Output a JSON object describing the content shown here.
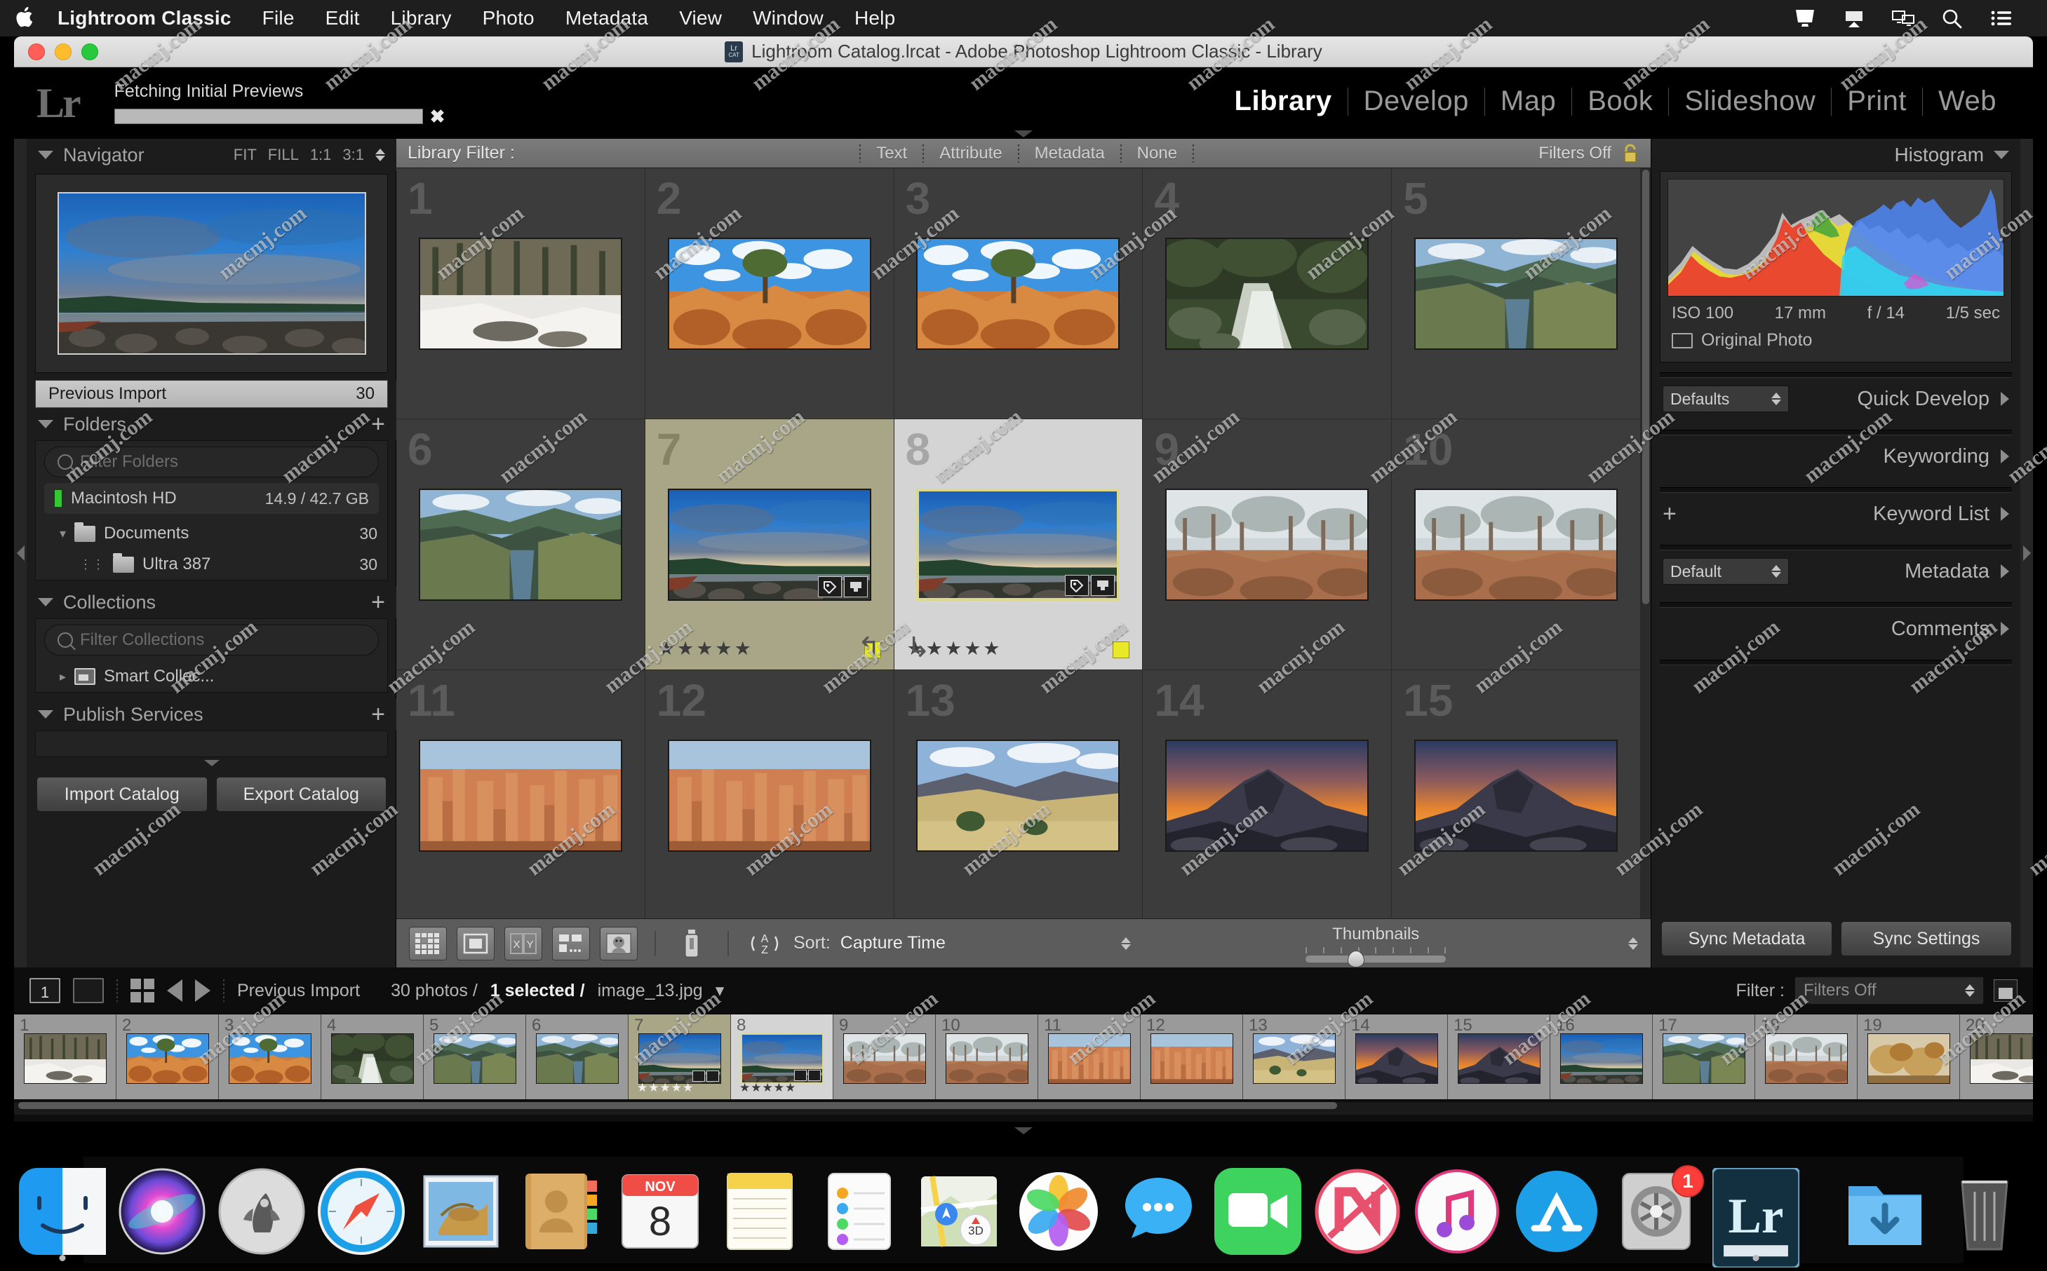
{
  "menubar": {
    "apple_icon": "apple-logo",
    "items": [
      {
        "label": "Lightroom Classic",
        "bold": true
      },
      {
        "label": "File"
      },
      {
        "label": "Edit"
      },
      {
        "label": "Library"
      },
      {
        "label": "Photo"
      },
      {
        "label": "Metadata"
      },
      {
        "label": "View"
      },
      {
        "label": "Window"
      },
      {
        "label": "Help"
      }
    ],
    "status_icons": [
      "display-icon",
      "airplay-icon",
      "screen-mirroring-icon",
      "search-icon",
      "control-center-icon"
    ]
  },
  "window": {
    "title": "Lightroom Catalog.lrcat - Adobe Photoshop Lightroom Classic - Library",
    "traffic_lights": [
      "close",
      "minimize",
      "zoom"
    ]
  },
  "identity": {
    "logo": "Lr",
    "progress_label": "Fetching Initial Previews",
    "progress_percent": 0,
    "close_label": "✖"
  },
  "modules": [
    {
      "label": "Library",
      "active": true
    },
    {
      "label": "Develop",
      "active": false
    },
    {
      "label": "Map",
      "active": false
    },
    {
      "label": "Book",
      "active": false
    },
    {
      "label": "Slideshow",
      "active": false
    },
    {
      "label": "Print",
      "active": false
    },
    {
      "label": "Web",
      "active": false
    }
  ],
  "left_panel": {
    "navigator": {
      "title": "Navigator",
      "zoom_levels": [
        "FIT",
        "FILL",
        "1:1",
        "3:1"
      ]
    },
    "catalog": {
      "previous_import_label": "Previous Import",
      "previous_import_count": "30"
    },
    "folders": {
      "title": "Folders",
      "filter_placeholder": "Filter Folders",
      "volume": {
        "name": "Macintosh HD",
        "space": "14.9 / 42.7 GB"
      },
      "items": [
        {
          "name": "Documents",
          "count": "30",
          "depth": 1
        },
        {
          "name": "Ultra 387",
          "count": "30",
          "depth": 2
        }
      ]
    },
    "collections": {
      "title": "Collections",
      "filter_placeholder": "Filter Collections",
      "items": [
        {
          "name": "Smart Collec..."
        }
      ]
    },
    "publish_services": {
      "title": "Publish Services"
    },
    "buttons": {
      "import": "Import Catalog",
      "export": "Export Catalog"
    }
  },
  "library_filter": {
    "label": "Library Filter :",
    "tabs": [
      "Text",
      "Attribute",
      "Metadata",
      "None"
    ],
    "status": "Filters Off",
    "lock_icon": "lock-icon"
  },
  "grid": {
    "cells": [
      {
        "num": "1",
        "state": "normal",
        "img": "snow-forest",
        "stars": 0,
        "badges": false,
        "label": false
      },
      {
        "num": "2",
        "state": "normal",
        "img": "arches-tree",
        "stars": 0,
        "badges": false,
        "label": false
      },
      {
        "num": "3",
        "state": "normal",
        "img": "arches-tree2",
        "stars": 0,
        "badges": false,
        "label": false
      },
      {
        "num": "4",
        "state": "normal",
        "img": "mossy-creek",
        "stars": 0,
        "badges": false,
        "label": false
      },
      {
        "num": "5",
        "state": "normal",
        "img": "canyon-river",
        "stars": 0,
        "badges": false,
        "label": false
      },
      {
        "num": "6",
        "state": "normal",
        "img": "canyon-river2",
        "stars": 0,
        "badges": false,
        "label": false
      },
      {
        "num": "7",
        "state": "selected",
        "img": "maui-storm",
        "stars": 5,
        "badges": true,
        "label": true
      },
      {
        "num": "8",
        "state": "active",
        "img": "maui-storm",
        "stars": 5,
        "badges": true,
        "label": true
      },
      {
        "num": "9",
        "state": "normal",
        "img": "misty-lake",
        "stars": 0,
        "badges": false,
        "label": false
      },
      {
        "num": "10",
        "state": "normal",
        "img": "misty-lake2",
        "stars": 0,
        "badges": false,
        "label": false
      },
      {
        "num": "11",
        "state": "normal",
        "img": "bryce-hoodoos",
        "stars": 0,
        "badges": false,
        "label": false
      },
      {
        "num": "12",
        "state": "normal",
        "img": "bryce-hoodoos2",
        "stars": 0,
        "badges": false,
        "label": false
      },
      {
        "num": "13",
        "state": "normal",
        "img": "prairie-hills",
        "stars": 0,
        "badges": false,
        "label": false
      },
      {
        "num": "14",
        "state": "normal",
        "img": "halfdome-sunset",
        "stars": 0,
        "badges": false,
        "label": false
      },
      {
        "num": "15",
        "state": "normal",
        "img": "halfdome-sunset2",
        "stars": 0,
        "badges": false,
        "label": false
      }
    ],
    "star_glyph": "★★★★★",
    "color_label": "#e9e92a"
  },
  "toolbar": {
    "view_icons": [
      "grid-view-icon",
      "loupe-view-icon",
      "compare-view-icon",
      "survey-view-icon",
      "people-view-icon"
    ],
    "paint_icon": "spray-can-icon",
    "sort_direction_icon": "sort-az-icon",
    "sort_label": "Sort:",
    "sort_value": "Capture Time",
    "thumbnails_label": "Thumbnails",
    "thumbnail_slider_value": 30
  },
  "right_panel": {
    "histogram": {
      "title": "Histogram",
      "iso": "ISO 100",
      "focal": "17 mm",
      "aperture": "f / 14",
      "shutter": "1/5 sec",
      "original_photo": "Original Photo"
    },
    "sections": [
      {
        "title": "Quick Develop",
        "dropdown": "Defaults",
        "plus": false
      },
      {
        "title": "Keywording",
        "dropdown": null,
        "plus": false
      },
      {
        "title": "Keyword List",
        "dropdown": null,
        "plus": true
      },
      {
        "title": "Metadata",
        "dropdown": "Default",
        "plus": false
      },
      {
        "title": "Comments",
        "dropdown": null,
        "plus": false
      }
    ],
    "buttons": {
      "sync_metadata": "Sync Metadata",
      "sync_settings": "Sync Settings"
    }
  },
  "filmstrip": {
    "window_num": "1",
    "source": "Previous Import",
    "count_text": "30 photos /",
    "selected_text": "1 selected /",
    "filename": "image_13.jpg",
    "filter_label": "Filter :",
    "filter_value": "Filters Off",
    "cells": [
      {
        "num": "1",
        "img": "snow-forest",
        "state": "normal",
        "stars": 0
      },
      {
        "num": "2",
        "img": "arches-tree",
        "state": "normal",
        "stars": 0
      },
      {
        "num": "3",
        "img": "arches-tree2",
        "state": "normal",
        "stars": 0
      },
      {
        "num": "4",
        "img": "mossy-creek",
        "state": "normal",
        "stars": 0
      },
      {
        "num": "5",
        "img": "canyon-river",
        "state": "normal",
        "stars": 0
      },
      {
        "num": "6",
        "img": "canyon-river2",
        "state": "normal",
        "stars": 0
      },
      {
        "num": "7",
        "img": "maui-storm",
        "state": "selected",
        "stars": 5
      },
      {
        "num": "8",
        "img": "maui-storm",
        "state": "active",
        "stars": 5
      },
      {
        "num": "9",
        "img": "misty-lake",
        "state": "normal",
        "stars": 0
      },
      {
        "num": "10",
        "img": "misty-lake2",
        "state": "normal",
        "stars": 0
      },
      {
        "num": "11",
        "img": "bryce-hoodoos",
        "state": "normal",
        "stars": 0
      },
      {
        "num": "12",
        "img": "bryce-hoodoos2",
        "state": "normal",
        "stars": 0
      },
      {
        "num": "13",
        "img": "prairie-hills",
        "state": "normal",
        "stars": 0
      },
      {
        "num": "14",
        "img": "halfdome-sunset",
        "state": "normal",
        "stars": 0
      },
      {
        "num": "15",
        "img": "halfdome-sunset2",
        "state": "normal",
        "stars": 0
      },
      {
        "num": "16",
        "img": "maui-storm",
        "state": "normal",
        "stars": 0
      },
      {
        "num": "17",
        "img": "canyon-river",
        "state": "normal",
        "stars": 0
      },
      {
        "num": "18",
        "img": "misty-lake",
        "state": "normal",
        "stars": 0
      },
      {
        "num": "19",
        "img": "autumn-leaf",
        "state": "normal",
        "stars": 0
      },
      {
        "num": "20",
        "img": "snow-forest",
        "state": "normal",
        "stars": 0
      }
    ]
  },
  "dock": {
    "items": [
      {
        "name": "finder",
        "running": true
      },
      {
        "name": "siri",
        "running": false
      },
      {
        "name": "launchpad",
        "running": false
      },
      {
        "name": "safari",
        "running": false
      },
      {
        "name": "mail",
        "running": false
      },
      {
        "name": "contacts",
        "running": false
      },
      {
        "name": "calendar",
        "running": false,
        "month": "NOV",
        "day": "8"
      },
      {
        "name": "notes",
        "running": false
      },
      {
        "name": "reminders",
        "running": false
      },
      {
        "name": "maps",
        "running": false,
        "badge_3d": "3D"
      },
      {
        "name": "photos",
        "running": false
      },
      {
        "name": "messages",
        "running": false
      },
      {
        "name": "facetime",
        "running": false
      },
      {
        "name": "news",
        "running": false
      },
      {
        "name": "itunes",
        "running": false
      },
      {
        "name": "app-store",
        "running": false
      },
      {
        "name": "system-preferences",
        "running": false,
        "badge": "1"
      },
      {
        "name": "lightroom-classic",
        "running": true,
        "label": "Lr"
      }
    ],
    "right_items": [
      {
        "name": "downloads-folder"
      },
      {
        "name": "trash"
      }
    ]
  },
  "watermark": {
    "text": "macmj.com"
  }
}
